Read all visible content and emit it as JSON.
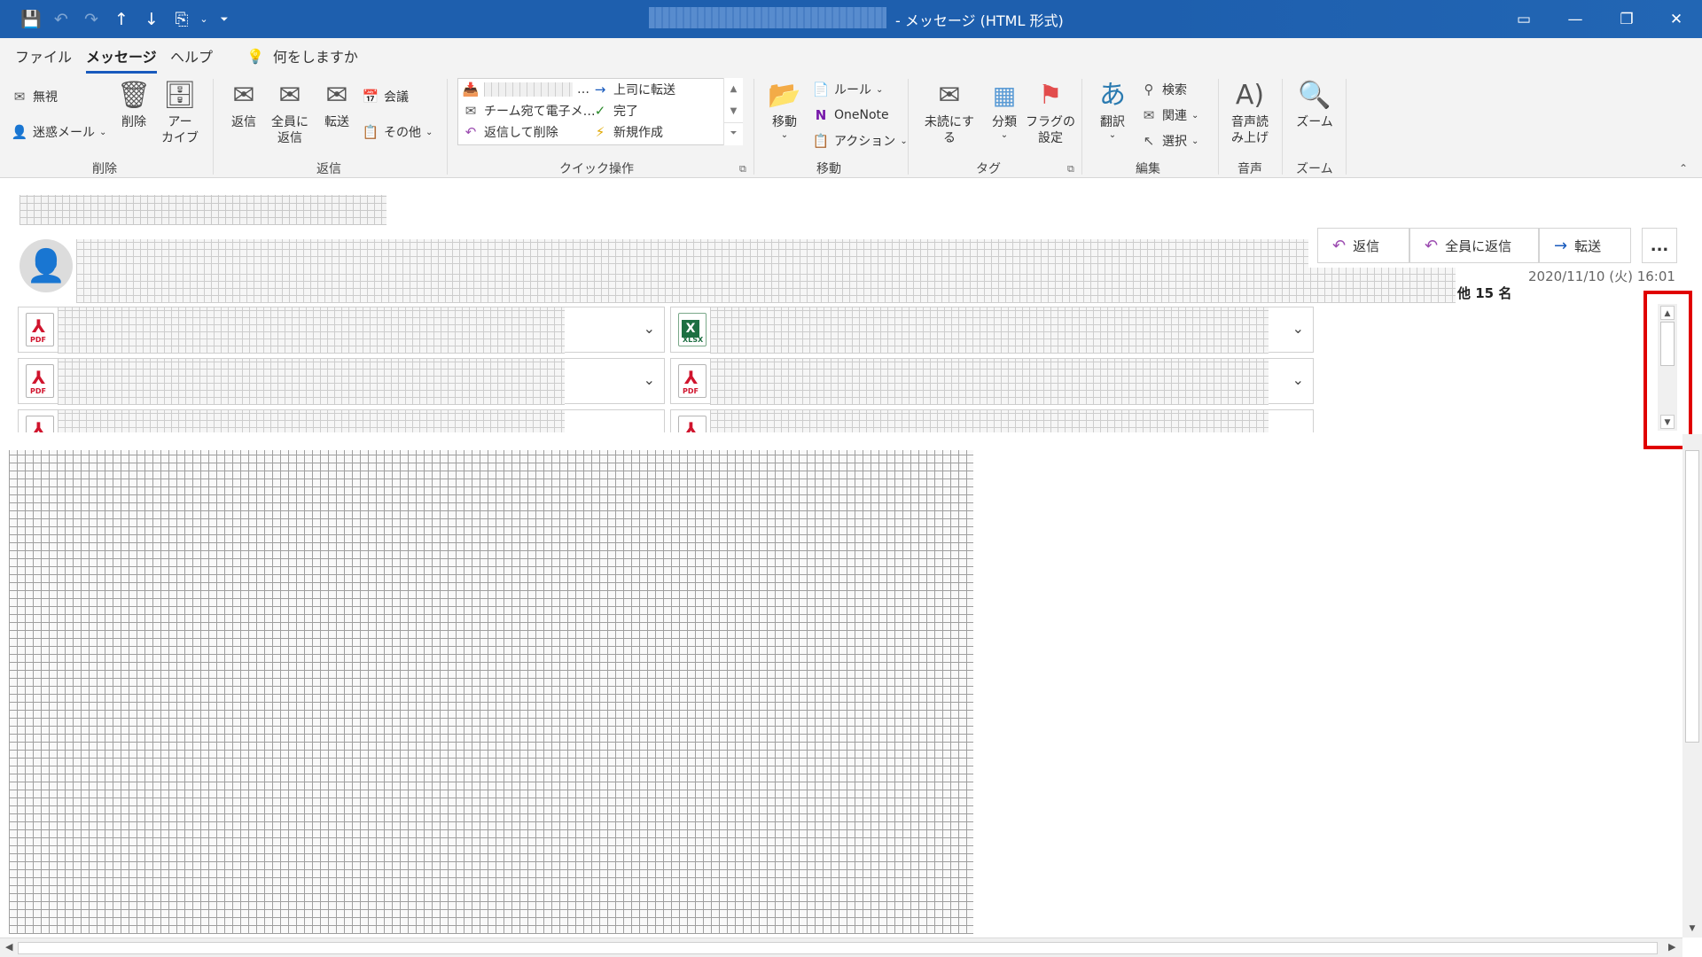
{
  "titlebar": {
    "title": "- メッセージ (HTML 形式)",
    "qat": [
      "save-icon",
      "undo-icon",
      "redo-icon",
      "up-arrow-icon",
      "down-arrow-icon",
      "attach-icon",
      "chevron-down-icon",
      "customize-icon"
    ],
    "window_controls": [
      "ribbon-display-icon",
      "minimize-icon",
      "restore-icon",
      "close-icon"
    ]
  },
  "menu": {
    "tabs": [
      "ファイル",
      "メッセージ",
      "ヘルプ"
    ],
    "active": "メッセージ",
    "tell_me": "何をしますか"
  },
  "ribbon": {
    "delete_group": {
      "label": "削除",
      "ignore": "無視",
      "junk": "迷惑メール",
      "delete": "削除",
      "archive": "アー\nカイブ"
    },
    "respond_group": {
      "label": "返信",
      "reply": "返信",
      "reply_all": "全員に\n返信",
      "forward": "転送",
      "meeting": "会議",
      "more": "その他"
    },
    "quick_steps": {
      "label": "クイック操作",
      "items": [
        "…",
        "上司に転送",
        "チーム宛て電子メ…",
        "完了",
        "返信して削除",
        "新規作成"
      ]
    },
    "move_group": {
      "label": "移動",
      "move": "移動",
      "rules": "ルール",
      "onenote": "OneNote",
      "actions": "アクション"
    },
    "tags_group": {
      "label": "タグ",
      "unread": "未読にする",
      "categorize": "分類",
      "followup": "フラグの\n設定"
    },
    "editing_group": {
      "label": "編集",
      "translate": "翻訳",
      "find": "検索",
      "related": "関連",
      "select": "選択"
    },
    "speech_group": {
      "label": "音声",
      "read_aloud": "音声読\nみ上げ"
    },
    "zoom_group": {
      "label": "ズーム",
      "zoom": "ズーム"
    }
  },
  "message": {
    "actions": {
      "reply": "返信",
      "reply_all": "全員に返信",
      "forward": "転送",
      "more": "..."
    },
    "date": "2020/11/10 (火) 16:01",
    "others": "他 15 名",
    "attachments": [
      {
        "type": "PDF"
      },
      {
        "type": "XLSX"
      },
      {
        "type": "PDF"
      },
      {
        "type": "PDF"
      },
      {
        "type": "PDF"
      },
      {
        "type": "PDF"
      }
    ]
  },
  "colors": {
    "titlebar": "#1e5fae",
    "accent": "#185abd",
    "highlight": "#e00000",
    "ribbon_bg": "#f3f3f3"
  }
}
